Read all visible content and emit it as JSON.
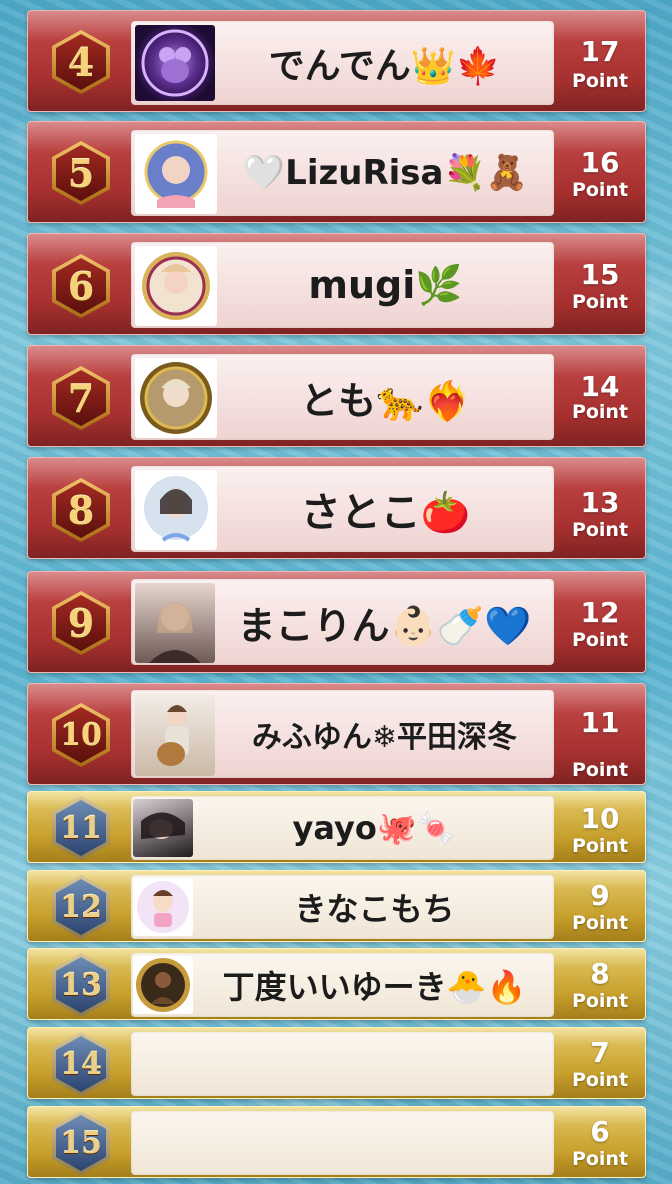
{
  "point_label": "Point",
  "rows": [
    {
      "rank": "4",
      "name": "でんでん👑🍁",
      "points": "17"
    },
    {
      "rank": "5",
      "name": "🤍LizuRisa💐🧸",
      "points": "16"
    },
    {
      "rank": "6",
      "name": "mugi🌿",
      "points": "15"
    },
    {
      "rank": "7",
      "name": "とも🐆❤️‍🔥",
      "points": "14"
    },
    {
      "rank": "8",
      "name": "さとこ🍅",
      "points": "13"
    },
    {
      "rank": "9",
      "name": "まこりん👶🏻🍼💙",
      "points": "12"
    },
    {
      "rank": "10",
      "name": "みふゆん❄平田深冬",
      "points": "11"
    },
    {
      "rank": "11",
      "name": "yayo🐙🍬",
      "points": "10"
    },
    {
      "rank": "12",
      "name": "きなこもち",
      "points": "9"
    },
    {
      "rank": "13",
      "name": "丁度いいゆーき🐣🔥",
      "points": "8"
    },
    {
      "rank": "14",
      "name": "",
      "points": "7"
    },
    {
      "rank": "15",
      "name": "",
      "points": "6"
    }
  ],
  "colors": {
    "red_row": "#a5302f",
    "gold_row": "#c79f2c",
    "badge_gold": "#f6d27a"
  }
}
